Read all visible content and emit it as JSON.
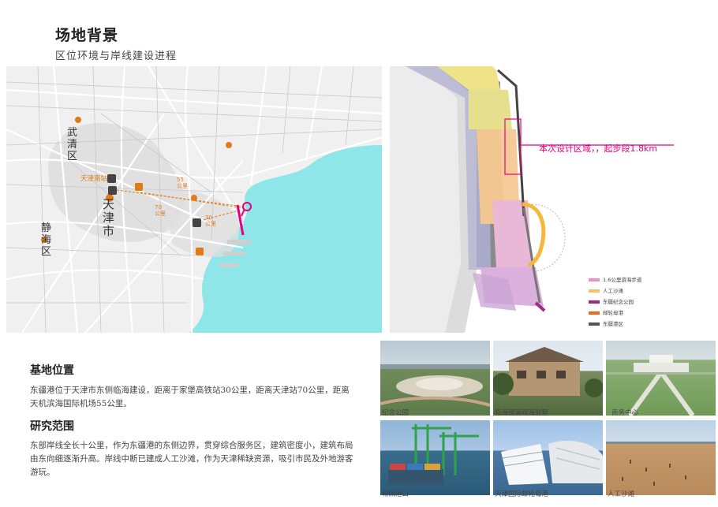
{
  "page": {
    "title": "场地背景",
    "subtitle": "区位环境与岸线建设进程"
  },
  "map": {
    "labels": {
      "wuqing": [
        "武",
        "清",
        "区"
      ],
      "tianjin": [
        "天",
        "津",
        "市"
      ],
      "jinghai": [
        "静",
        "海",
        "区"
      ],
      "station": "天津南站",
      "dist_55": "55\n公里",
      "dist_70": "70\n公里",
      "dist_30": "30\n公里"
    },
    "colors": {
      "sea": "#8ee6e8",
      "marker": "#e07b1a",
      "pin": "#e6007e"
    }
  },
  "plan": {
    "callout": "本次设计区域，，起步段1.8km",
    "legend": [
      {
        "label": "1.6公里游海步道",
        "color": "#f08ec0"
      },
      {
        "label": "人工沙滩",
        "color": "#f5c266"
      },
      {
        "label": "东疆纪念公园",
        "color": "#a0278c"
      },
      {
        "label": "邮轮母港",
        "color": "#e86a1b"
      },
      {
        "label": "东疆港区",
        "color": "#555555"
      }
    ]
  },
  "sections": {
    "location": {
      "heading": "基地位置",
      "text": "东疆港位于天津市东侧临海建设，距离于家堡高铁站30公里，距离天津站70公里，距离天机滨海国际机场55公里。"
    },
    "scope": {
      "heading": "研究范围",
      "text": "东部岸线全长十公里，作为东疆港的东侧边界，贯穿综合服务区，建筑密度小，建筑布局由东向细逐渐升高。岸线中断已建成人工沙滩，作为天津稀缺资源，吸引市民及外地游客游玩。"
    }
  },
  "photos": [
    {
      "caption": "纪念公园"
    },
    {
      "caption": "临海观澜观海别墅"
    },
    {
      "caption": "商务中心"
    },
    {
      "caption": "物流港口"
    },
    {
      "caption": "天津国际邮轮母港"
    },
    {
      "caption": "人工沙滩"
    }
  ]
}
